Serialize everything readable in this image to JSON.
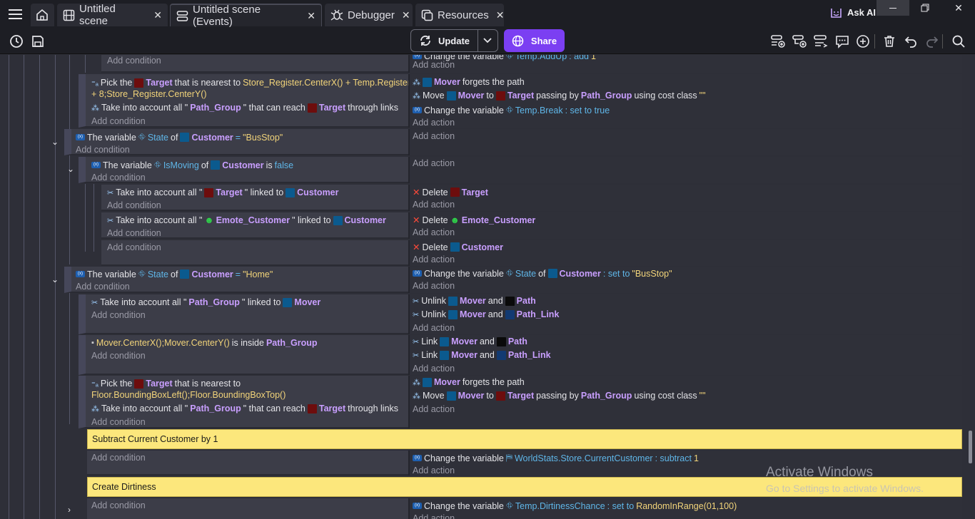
{
  "app": {
    "ask_ai": "Ask AI"
  },
  "tabs": [
    {
      "label": "Untitled scene"
    },
    {
      "label": "Untitled scene (Events)"
    },
    {
      "label": "Debugger"
    },
    {
      "label": "Resources"
    }
  ],
  "toolbar": {
    "update": "Update",
    "share": "Share"
  },
  "common": {
    "add_condition": "Add condition",
    "add_action": "Add action"
  },
  "ev1": {
    "act": {
      "a": "Change the variable",
      "b": "Temp.AddUp",
      "c": ": add",
      "d": "1"
    }
  },
  "ev2": {
    "c1": {
      "a": "Pick the",
      "b": "Target",
      "c": "that is nearest to",
      "d": "Store_Register.CenterX() + Temp.Register.X",
      "e": "+ 8;Store_Register.CenterY()"
    },
    "c2": {
      "a": "Take into account all \"",
      "b": "Path_Group",
      "c": "\" that can reach",
      "d": "Target",
      "e": "through links"
    },
    "a1": {
      "a": "Mover",
      "b": "forgets the path"
    },
    "a2": {
      "a": "Move",
      "b": "Mover",
      "c": "to",
      "d": "Target",
      "e": "passing by",
      "f": "Path_Group",
      "g": "using cost class",
      "h": "\"\""
    },
    "a3": {
      "a": "Change the variable",
      "b": "Temp.Break",
      "c": ": set to true"
    }
  },
  "ev3": {
    "c1": {
      "a": "The variable",
      "b": "State",
      "c": "of",
      "d": "Customer",
      "e": "=",
      "f": "\"BusStop\""
    }
  },
  "ev4": {
    "c1": {
      "a": "The variable",
      "b": "IsMoving",
      "c": "of",
      "d": "Customer",
      "e": "is",
      "f": "false"
    }
  },
  "ev5": {
    "c1": {
      "a": "Take into account all \"",
      "b": "Target",
      "c": "\" linked to",
      "d": "Customer"
    },
    "a1": {
      "a": "Delete",
      "b": "Target"
    }
  },
  "ev6": {
    "c1": {
      "a": "Take into account all \"",
      "b": "Emote_Customer",
      "c": "\" linked to",
      "d": "Customer"
    },
    "a1": {
      "a": "Delete",
      "b": "Emote_Customer"
    }
  },
  "ev7": {
    "a1": {
      "a": "Delete",
      "b": "Customer"
    }
  },
  "ev8": {
    "c1": {
      "a": "The variable",
      "b": "State",
      "c": "of",
      "d": "Customer",
      "e": "=",
      "f": "\"Home\""
    },
    "a1": {
      "a": "Change the variable",
      "b": "State",
      "c": "of",
      "d": "Customer",
      "e": ": set to",
      "f": "\"BusStop\""
    }
  },
  "ev9": {
    "c1": {
      "a": "Take into account all \"",
      "b": "Path_Group",
      "c": "\" linked to",
      "d": "Mover"
    },
    "a1": {
      "a": "Unlink",
      "b": "Mover",
      "c": "and",
      "d": "Path"
    },
    "a2": {
      "a": "Unlink",
      "b": "Mover",
      "c": "and",
      "d": "Path_Link"
    }
  },
  "ev10": {
    "c1": {
      "a": "Mover.CenterX();Mover.CenterY()",
      "b": "is inside",
      "c": "Path_Group"
    },
    "a1": {
      "a": "Link",
      "b": "Mover",
      "c": "and",
      "d": "Path"
    },
    "a2": {
      "a": "Link",
      "b": "Mover",
      "c": "and",
      "d": "Path_Link"
    }
  },
  "ev11": {
    "c1": {
      "a": "Pick the",
      "b": "Target",
      "c": "that is nearest to",
      "d": "Floor.BoundingBoxLeft();Floor.BoundingBoxTop()"
    },
    "c2": {
      "a": "Take into account all \"",
      "b": "Path_Group",
      "c": "\" that can reach",
      "d": "Target",
      "e": "through links"
    },
    "a1": {
      "a": "Mover",
      "b": "forgets the path"
    },
    "a2": {
      "a": "Move",
      "b": "Mover",
      "c": "to",
      "d": "Target",
      "e": "passing by",
      "f": "Path_Group",
      "g": "using cost class",
      "h": "\"\""
    }
  },
  "comment1": "Subtract Current Customer by 1",
  "ev12": {
    "a1": {
      "a": "Change the variable",
      "b": "WorldStats.Store.CurrentCustomer",
      "c": ": subtract",
      "d": "1"
    }
  },
  "comment2": "Create Dirtiness",
  "ev13": {
    "a1": {
      "a": "Change the variable",
      "b": "Temp.DirtinessChance",
      "c": ": set to",
      "d": "RandomInRange(01,100)"
    }
  },
  "watermark": {
    "line1": "Activate Windows",
    "line2": "Go to Settings to activate Windows."
  }
}
